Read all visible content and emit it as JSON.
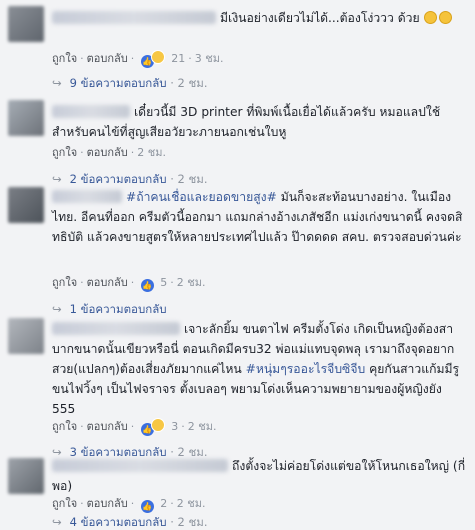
{
  "ui": {
    "like": "ถูกใจ",
    "reply": "ตอบกลับ",
    "dot": "·",
    "arrow": "↪"
  },
  "comments": [
    {
      "text": "มีเงินอย่างเดียวไม่ได้...ต้องโง่ววว ด้วย",
      "reactions": [
        "like",
        "haha"
      ],
      "reaction_count": "21",
      "time": "3 ชม.",
      "replies": "9 ข้อความตอบกลับ",
      "replies_time": "2 ชม."
    },
    {
      "text": "เดี๋ยวนี้มี 3D printer ที่พิมพ์เนื้อเยื่อได้แล้วครับ หมอแลปใช้สำหรับคนไข้ที่สูญเสียอวัยวะภายนอกเช่นใบหู",
      "time": "2 ชม.",
      "replies": "2 ข้อความตอบกลับ",
      "replies_time": "2 ชม."
    },
    {
      "hashtag": "#ถ้าคนเชื่อและยอดขายสูง#",
      "text": " มันก็จะสะท้อนบางอย่าง. ในเมืองไทย. อีคนที่ออก ครีมตัวนี้ออกมา แถมกล่างอ้างเภสัชอีก แม่งเก่งขนาดนี้ คงจดสิทธิบัติ แล้วคงขายสูตรให้หลายประเทศไปแล้ว ป๊าดดดด สคบ. ตรวจสอบด่วนค่ะ",
      "reactions": [
        "like"
      ],
      "reaction_count": "5",
      "time": "2 ชม.",
      "replies": "1 ข้อความตอบกลับ"
    },
    {
      "text_a": "เจาะลักยิ้ม ขนตาไฟ ครีมตั้งโด่ง เกิดเป็นหญิงต้องสาบากขนาดนั้นเขียวหรือนี่ ตอนเกิดมีครบ32 พ่อแม่แทบจุดพลุ เรามาถึงจุดอยากสวย(แปลกๆ)ต้องเสี่ยงภัยมากแค่ไหน ",
      "hashtag": "#หนุ่มๆรออะไรจีบซิจีบ",
      "text_b": " คุยกันสาวแก้มมีรู ขนไฟวิ้งๆ เป็นไฟจราจร ตั้งเบลอๆ พยามโด่งเห็นความพยายามของผู้หญิงยัง 555",
      "reactions": [
        "like",
        "haha"
      ],
      "reaction_count": "3",
      "time": "2 ชม.",
      "replies": "3 ข้อความตอบกลับ",
      "replies_time": "2 ชม."
    },
    {
      "text": "ถึงตั้งจะไม่ค่อยโด่งแต่ขอให้โหนกเธอใหญ่ (กี่พอ)",
      "reactions": [
        "like"
      ],
      "reaction_count": "2",
      "time": "2 ชม.",
      "replies": "4 ข้อความตอบกลับ",
      "replies_time": "2 ชม."
    }
  ]
}
